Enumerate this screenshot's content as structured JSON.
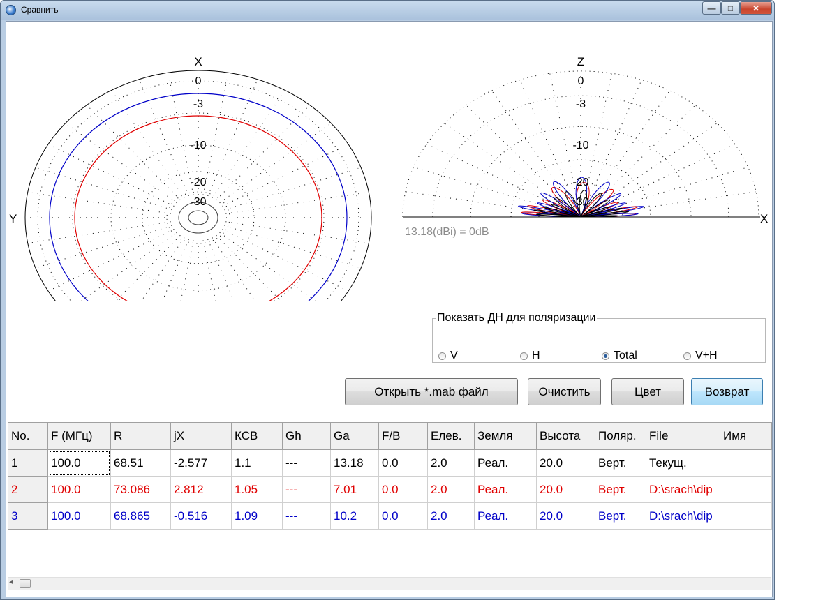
{
  "window": {
    "title": "Сравнить",
    "icon": "app-icon",
    "controls": {
      "minimize": "—",
      "maximize": "□",
      "close": "✕"
    }
  },
  "colors": {
    "series_black": "#000000",
    "series_red": "#e00000",
    "series_blue": "#0000c8",
    "grid_dots": "#000000"
  },
  "azimuth_plot": {
    "axis_top": "X",
    "axis_left": "Y",
    "ring_labels": [
      "0",
      "-3",
      "-10",
      "-20",
      "-30"
    ]
  },
  "elevation_plot": {
    "axis_top": "Z",
    "axis_right": "X",
    "ring_labels": [
      "0",
      "-3",
      "-10",
      "-20",
      "-30"
    ],
    "gain_reference": "13.18(dBi) = 0dB"
  },
  "polarization": {
    "legend": "Показать ДН для поляризации",
    "options": [
      {
        "label": "V",
        "selected": false
      },
      {
        "label": "H",
        "selected": false
      },
      {
        "label": "Total",
        "selected": true
      },
      {
        "label": "V+H",
        "selected": false
      }
    ]
  },
  "buttons": {
    "open": "Открыть *.mab файл",
    "clear": "Очистить",
    "color": "Цвет",
    "back": "Возврат"
  },
  "table": {
    "headers": [
      "No.",
      "F (МГц)",
      "R",
      "jX",
      "КСВ",
      "Gh",
      "Ga",
      "F/B",
      "Елев.",
      "Земля",
      "Высота",
      "Поляр.",
      "File",
      "Имя"
    ],
    "rows": [
      [
        "1",
        "100.0",
        "68.51",
        "-2.577",
        "1.1",
        "---",
        "13.18",
        "0.0",
        "2.0",
        "Реал.",
        "20.0",
        "Верт.",
        "Текущ.",
        ""
      ],
      [
        "2",
        "100.0",
        "73.086",
        "2.812",
        "1.05",
        "---",
        "7.01",
        "0.0",
        "2.0",
        "Реал.",
        "20.0",
        "Верт.",
        "D:\\srach\\dip",
        ""
      ],
      [
        "3",
        "100.0",
        "68.865",
        "-0.516",
        "1.09",
        "---",
        "10.2",
        "0.0",
        "2.0",
        "Реал.",
        "20.0",
        "Верт.",
        "D:\\srach\\dip",
        ""
      ]
    ]
  },
  "scrollbar": {
    "left_arrow": "◂"
  }
}
